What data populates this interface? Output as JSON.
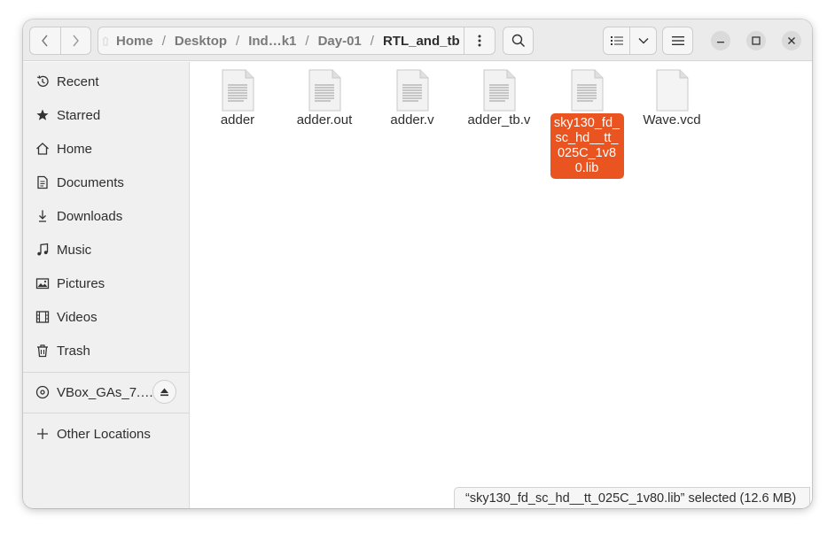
{
  "breadcrumbs": [
    "Home",
    "Desktop",
    "Ind…k1",
    "Day-01",
    "RTL_and_tb"
  ],
  "breadcrumb_separator": "/",
  "sidebar": {
    "items": [
      {
        "label": "Recent",
        "icon": "clock-icon"
      },
      {
        "label": "Starred",
        "icon": "star-icon"
      },
      {
        "label": "Home",
        "icon": "home-icon"
      },
      {
        "label": "Documents",
        "icon": "document-icon"
      },
      {
        "label": "Downloads",
        "icon": "download-icon"
      },
      {
        "label": "Music",
        "icon": "music-icon"
      },
      {
        "label": "Pictures",
        "icon": "picture-icon"
      },
      {
        "label": "Videos",
        "icon": "video-icon"
      },
      {
        "label": "Trash",
        "icon": "trash-icon"
      }
    ],
    "device": {
      "label": "VBox_GAs_7.…",
      "icon": "disc-icon",
      "eject_icon": "eject-icon"
    },
    "other_locations": {
      "label": "Other Locations",
      "icon": "plus-icon"
    }
  },
  "files": [
    {
      "name": "adder",
      "icon": "text-file-icon",
      "selected": false
    },
    {
      "name": "adder.out",
      "icon": "text-file-icon",
      "selected": false
    },
    {
      "name": "adder.v",
      "icon": "text-file-icon",
      "selected": false
    },
    {
      "name": "adder_tb.v",
      "icon": "text-file-icon",
      "selected": false
    },
    {
      "name": "sky130_fd_sc_hd__tt_025C_1v80.lib",
      "icon": "text-file-icon",
      "selected": true
    },
    {
      "name": "Wave.vcd",
      "icon": "blank-file-icon",
      "selected": false
    }
  ],
  "status": {
    "text": "“sky130_fd_sc_hd__tt_025C_1v80.lib” selected  (12.6 MB)"
  },
  "colors": {
    "accent": "#e95420",
    "header": "#ebebeb",
    "sidebar": "#f0f0f0"
  }
}
